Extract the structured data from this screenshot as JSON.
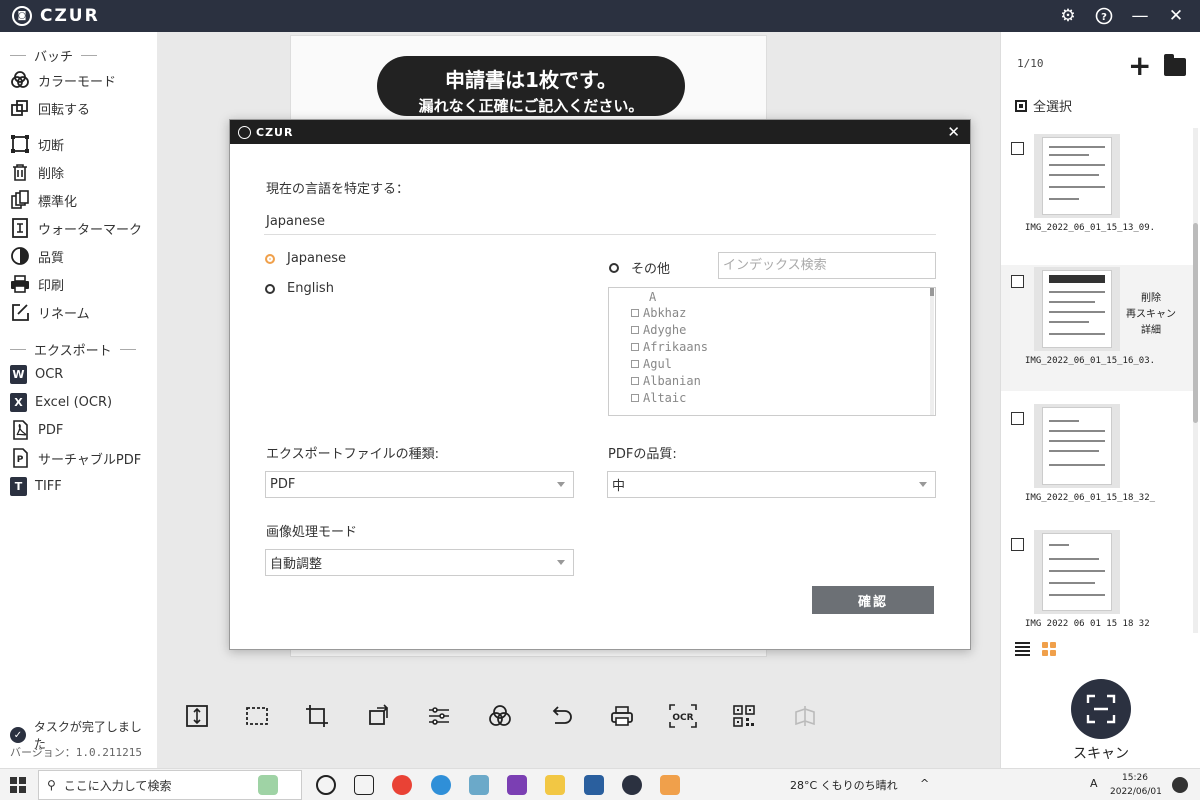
{
  "app": {
    "logo_text": "CZUR"
  },
  "sidebar": {
    "batch_title": "バッチ",
    "batch_items": [
      {
        "label": "カラーモード",
        "icon": "color-mode-icon"
      },
      {
        "label": "回転する",
        "icon": "rotate-icon"
      },
      {
        "label": "切断",
        "icon": "crop-icon"
      },
      {
        "label": "削除",
        "icon": "trash-icon"
      },
      {
        "label": "標準化",
        "icon": "standardize-icon"
      },
      {
        "label": "ウォーターマーク",
        "icon": "watermark-icon"
      },
      {
        "label": "品質",
        "icon": "quality-icon"
      },
      {
        "label": "印刷",
        "icon": "print-icon"
      },
      {
        "label": "リネーム",
        "icon": "rename-icon"
      }
    ],
    "export_title": "エクスポート",
    "export_items": [
      {
        "label": "OCR",
        "icon_text": "W"
      },
      {
        "label": "Excel (OCR)",
        "icon_text": "X"
      },
      {
        "label": "PDF",
        "icon_text": "PDF"
      },
      {
        "label": "サーチャブルPDF",
        "icon_text": "P"
      },
      {
        "label": "TIFF",
        "icon_text": "T"
      }
    ],
    "task_status": "タスクが完了しまし た",
    "version": "バージョン：1.0.211215"
  },
  "document": {
    "banner_line1": "申請書は1枚です。",
    "banner_line2": "漏れなく正確にご記入ください。"
  },
  "toolbar": {
    "ocr_label": "OCR"
  },
  "right_panel": {
    "count": "1/10",
    "select_all": "全選択",
    "thumbnails": [
      {
        "name": "IMG_2022_06_01_15_13_09.",
        "active": false
      },
      {
        "name": "IMG_2022_06_01_15_16_03.",
        "active": true
      },
      {
        "name": "IMG_2022_06_01_15_18_32_",
        "active": false
      },
      {
        "name": "IMG 2022 06 01 15 18 32",
        "active": false
      }
    ],
    "actions": {
      "delete": "削除",
      "rescan": "再スキャン",
      "details": "詳細"
    },
    "scan_label": "スキャン"
  },
  "modal": {
    "logo_text": "CZUR",
    "lang_prompt": "現在の言語を特定する：",
    "lang_current": "Japanese",
    "radio_japanese": "Japanese",
    "radio_english": "English",
    "radio_other": "その他",
    "search_placeholder": "インデックス検索",
    "lang_list_letter": "A",
    "lang_list": [
      "Abkhaz",
      "Adyghe",
      "Afrikaans",
      "Agul",
      "Albanian",
      "Altaic"
    ],
    "export_type_label": "エクスポートファイルの種類:",
    "export_type_value": "PDF",
    "pdf_quality_label": "PDFの品質:",
    "pdf_quality_value": "中",
    "image_mode_label": "画像処理モード",
    "image_mode_value": "自動調整",
    "confirm": "確認"
  },
  "taskbar": {
    "search_placeholder": "ここに入力して検索",
    "weather": "28°C くもりのち晴れ",
    "ime": "A",
    "time": "15:26",
    "date": "2022/06/01"
  },
  "colors": {
    "titlebar": "#2b3140",
    "accent": "#f0a04b",
    "confirm": "#6c7075"
  }
}
